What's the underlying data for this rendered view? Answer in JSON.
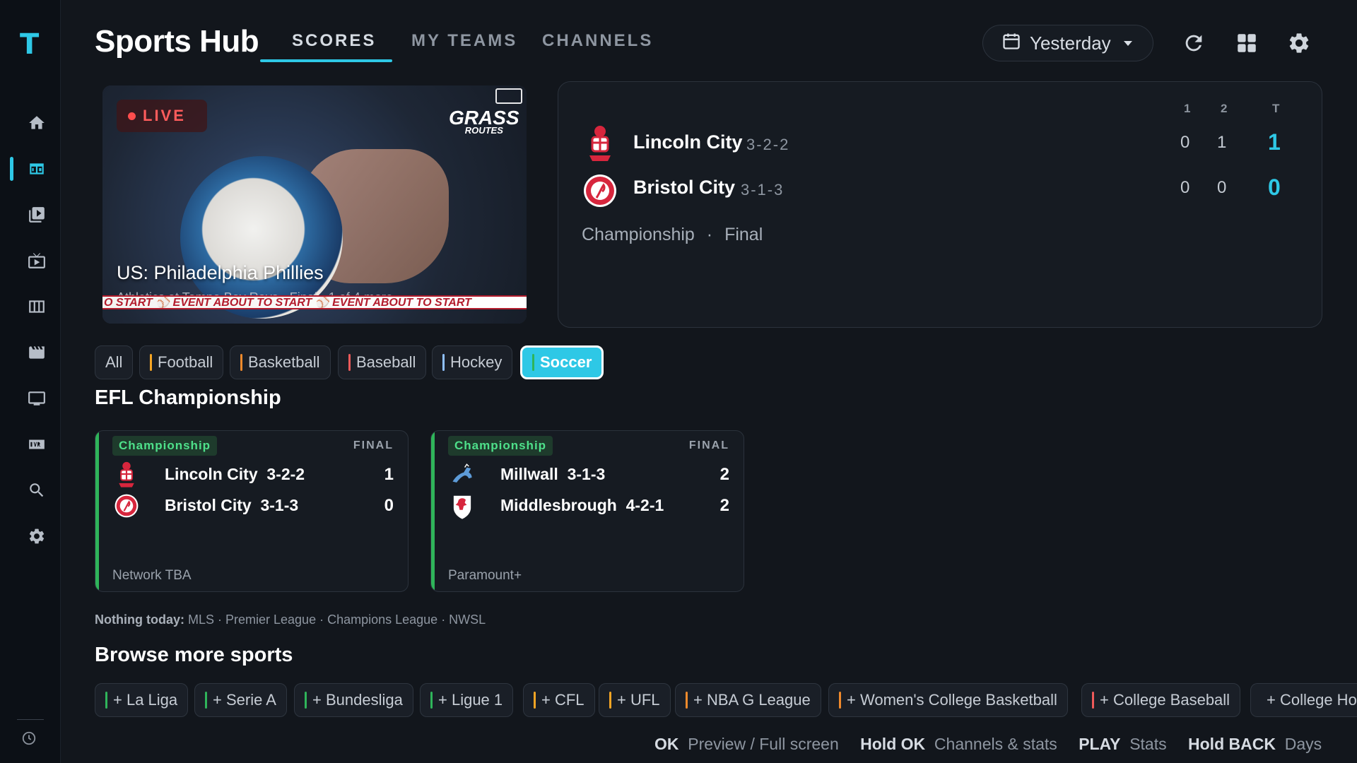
{
  "sidebar": {
    "logo": "T",
    "items": [
      {
        "name": "home",
        "icon": "home-icon"
      },
      {
        "name": "scores",
        "icon": "scoreboard-icon",
        "active": true
      },
      {
        "name": "library",
        "icon": "library-icon"
      },
      {
        "name": "live-tv",
        "icon": "live-tv-icon"
      },
      {
        "name": "guide",
        "icon": "guide-icon"
      },
      {
        "name": "movies",
        "icon": "movies-icon"
      },
      {
        "name": "devices",
        "icon": "monitor-icon"
      },
      {
        "name": "dvr",
        "icon": "dvr-icon"
      },
      {
        "name": "search",
        "icon": "search-icon"
      },
      {
        "name": "settings",
        "icon": "gear-icon"
      }
    ]
  },
  "header": {
    "title": "Sports Hub",
    "tabs": [
      {
        "label": "SCORES",
        "active": true
      },
      {
        "label": "MY TEAMS"
      },
      {
        "label": "CHANNELS"
      }
    ],
    "date_selector": "Yesterday",
    "icons": [
      "refresh-icon",
      "grid-icon",
      "gear-icon"
    ]
  },
  "preview": {
    "live_label": "LIVE",
    "title": "US: Philadelphia Phillies",
    "subtitle": "Athletics at Tampa Bay Rays · Final · 1 of 4 more",
    "brand": "GRASS",
    "brand_sub": "ROUTES",
    "ticker": "O START  ⚾  EVENT ABOUT TO START  ⚾  EVENT ABOUT TO START"
  },
  "scoreboard": {
    "col_headers": [
      "1",
      "2",
      "T"
    ],
    "teams": [
      {
        "name": "Lincoln City",
        "record": "3-2-2",
        "periods": [
          "0",
          "1"
        ],
        "total": "1"
      },
      {
        "name": "Bristol City",
        "record": "3-1-3",
        "periods": [
          "0",
          "0"
        ],
        "total": "0"
      }
    ],
    "league": "Championship",
    "separator": "·",
    "status": "Final"
  },
  "filters": [
    {
      "label": "All",
      "color": ""
    },
    {
      "label": "Football",
      "color": "#f5a524"
    },
    {
      "label": "Basketball",
      "color": "#f08a2c"
    },
    {
      "label": "Baseball",
      "color": "#ef5a5a"
    },
    {
      "label": "Hockey",
      "color": "#8fc0ff"
    },
    {
      "label": "Soccer",
      "color": "#2fb45a",
      "selected": true
    }
  ],
  "section_title": "EFL Championship",
  "games": [
    {
      "league": "Championship",
      "status": "FINAL",
      "teams": [
        {
          "name": "Lincoln City",
          "record": "3-2-2",
          "score": "1"
        },
        {
          "name": "Bristol City",
          "record": "3-1-3",
          "score": "0"
        }
      ],
      "network": "Network TBA"
    },
    {
      "league": "Championship",
      "status": "FINAL",
      "teams": [
        {
          "name": "Millwall",
          "record": "3-1-3",
          "score": "2"
        },
        {
          "name": "Middlesbrough",
          "record": "4-2-1",
          "score": "2"
        }
      ],
      "network": "Paramount+"
    }
  ],
  "nothing_today": {
    "label": "Nothing today:",
    "leagues": "MLS · Premier League · Champions League · NWSL"
  },
  "browse": {
    "title": "Browse more sports",
    "items": [
      {
        "label": "+ La Liga",
        "color": "#2fb45a"
      },
      {
        "label": "+ Serie A",
        "color": "#2fb45a"
      },
      {
        "label": "+ Bundesliga",
        "color": "#2fb45a"
      },
      {
        "label": "+ Ligue 1",
        "color": "#2fb45a"
      },
      {
        "label": "+ CFL",
        "color": "#f5a524"
      },
      {
        "label": "+ UFL",
        "color": "#f5a524"
      },
      {
        "label": "+ NBA G League",
        "color": "#f08a2c"
      },
      {
        "label": "+ Women's College Basketball",
        "color": "#f08a2c"
      },
      {
        "label": "+ College Baseball",
        "color": "#ef5a5a"
      },
      {
        "label": "+ College Ho",
        "color": "#8fc0ff"
      }
    ]
  },
  "hints": [
    {
      "key": "OK",
      "action": "Preview / Full screen"
    },
    {
      "key": "Hold OK",
      "action": "Channels & stats"
    },
    {
      "key": "PLAY",
      "action": "Stats"
    },
    {
      "key": "Hold BACK",
      "action": "Days"
    }
  ],
  "colors": {
    "accent": "#2ec8e6",
    "soccer": "#2fb45a",
    "live": "#ff4d4d",
    "background": "#12161c"
  }
}
